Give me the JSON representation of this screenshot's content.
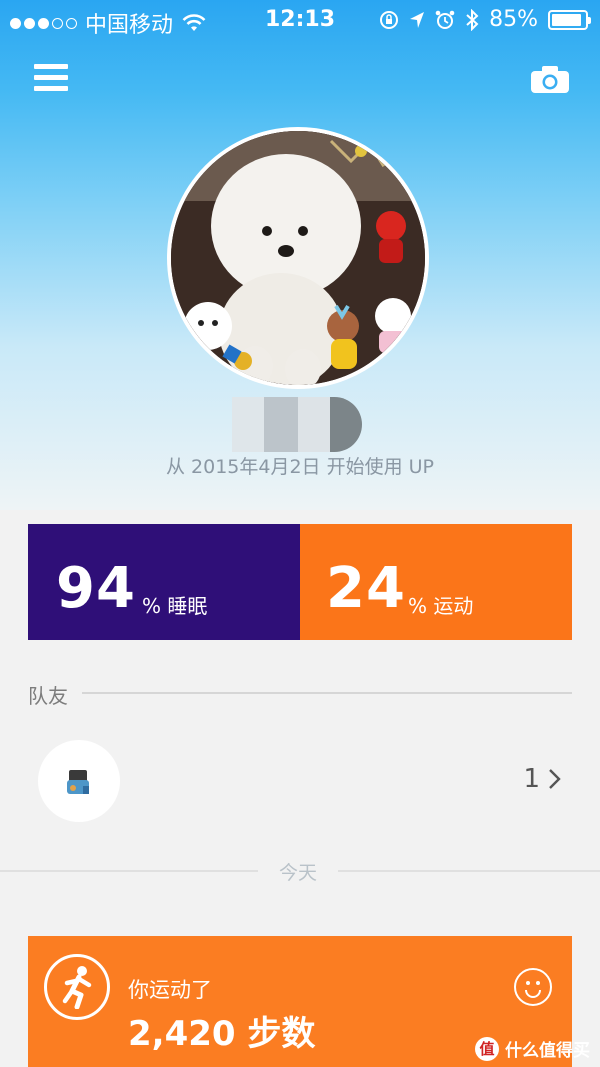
{
  "status_bar": {
    "carrier": "中国移动",
    "time": "12:13",
    "battery": "85%",
    "signal_dots_filled": 3,
    "signal_dots_total": 5
  },
  "header": {
    "menu_icon": "hamburger-menu-icon",
    "camera_icon": "camera-icon"
  },
  "profile": {
    "since_text": "从 2015年4月2日 开始使用 UP"
  },
  "stats": {
    "sleep": {
      "value": "94",
      "unit": "% 睡眠",
      "color": "#2f0f78"
    },
    "activity": {
      "value": "24",
      "unit": "% 运动",
      "color": "#fb7519"
    }
  },
  "team": {
    "label": "队友",
    "count": "1"
  },
  "today": {
    "label": "今天"
  },
  "activity_card": {
    "label": "你运动了",
    "value": "2,420 步数",
    "color": "#fb7d22"
  },
  "watermark": {
    "logo": "值",
    "text": "什么值得买"
  }
}
